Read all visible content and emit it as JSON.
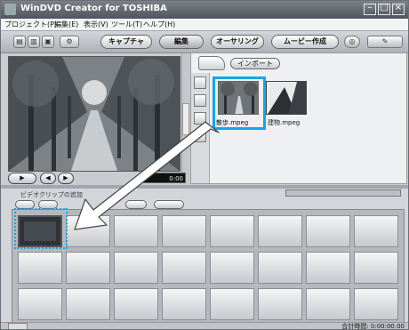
{
  "window": {
    "title": "WinDVD Creator for TOSHIBA"
  },
  "menu": {
    "items": [
      "プロジェクト(P)",
      "編集(E)",
      "表示(V)",
      "ツール(T)",
      "ヘルプ(H)"
    ]
  },
  "toolbar": {
    "capture": "キャプチャ",
    "edit": "編集",
    "authoring": "オーサリング",
    "movie_create": "ムービー作成"
  },
  "player": {
    "timecode": "0:00"
  },
  "library": {
    "import_label": "インポート",
    "clips": [
      {
        "name": "散歩.mpeg"
      },
      {
        "name": "建物.mpeg"
      }
    ]
  },
  "bottom": {
    "label": "ビデオクリップの追加"
  },
  "status": {
    "total_time": "合計時間: 0:00:00.00"
  },
  "colors": {
    "highlight": "#12a6e8"
  }
}
